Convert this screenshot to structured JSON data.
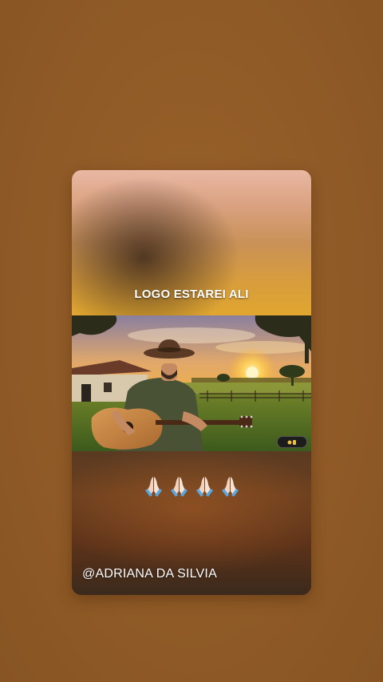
{
  "story": {
    "caption_top": "LOGO ESTAREI ALI",
    "handle": "@ADRIANA DA SILVIA",
    "emoji": [
      "🙏",
      "🙏",
      "🙏",
      "🙏"
    ]
  },
  "colors": {
    "page_background": "#8f5a26",
    "sunset": "#f2b13a",
    "text": "#ffffff"
  },
  "icons": [
    "folded-hands-icon",
    "reaction-badge-icon"
  ]
}
